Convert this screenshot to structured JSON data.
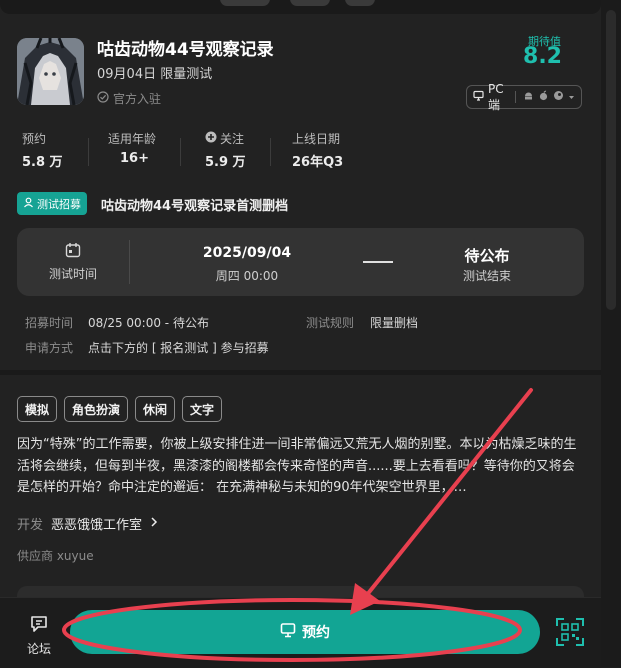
{
  "header": {
    "title": "咕齿动物44号观察记录",
    "subtitle": "09月04日 限量测试",
    "official": "官方入驻",
    "score_label": "期待值",
    "score": "8.2",
    "platform_label": "PC端"
  },
  "stats": [
    {
      "label": "预约",
      "value": "5.8 万"
    },
    {
      "label": "适用年龄",
      "value": "16+"
    },
    {
      "label": "关注",
      "value": "5.9 万"
    },
    {
      "label": "上线日期",
      "value": "26年Q3"
    }
  ],
  "recruit": {
    "badge": "测试招募",
    "title": "咕齿动物44号观察记录首测删档",
    "test_time_label": "测试时间",
    "date": "2025/09/04",
    "weekday_time": "周四 00:00",
    "end_status": "待公布",
    "end_label": "测试结束",
    "recruit_time_key": "招募时间",
    "recruit_time_value": "08/25 00:00 - 待公布",
    "rule_key": "测试规则",
    "rule_value": "限量删档",
    "apply_key": "申请方式",
    "apply_value": "点击下方的 [ 报名测试 ] 参与招募"
  },
  "tags": [
    "模拟",
    "角色扮演",
    "休闲",
    "文字"
  ],
  "description": "因为“特殊”的工作需要，你被上级安排住进一间非常偏远又荒无人烟的别墅。本以为枯燥乏味的生活将会继续，但每到半夜，黑漆漆的阁楼都会传来奇怪的声音......要上去看看吗？等待你的又将会是怎样的开始？命中注定的邂逅： 在充满神秘与未知的90年代架空世界里，…",
  "developer": {
    "key": "开发",
    "value": "恶恶饿饿工作室"
  },
  "supplier": "供应商 xuyue",
  "bottom": {
    "forum_label": "论坛",
    "reserve_label": "预约"
  },
  "colors": {
    "accent": "#12a594",
    "annotation": "#e8404f"
  }
}
